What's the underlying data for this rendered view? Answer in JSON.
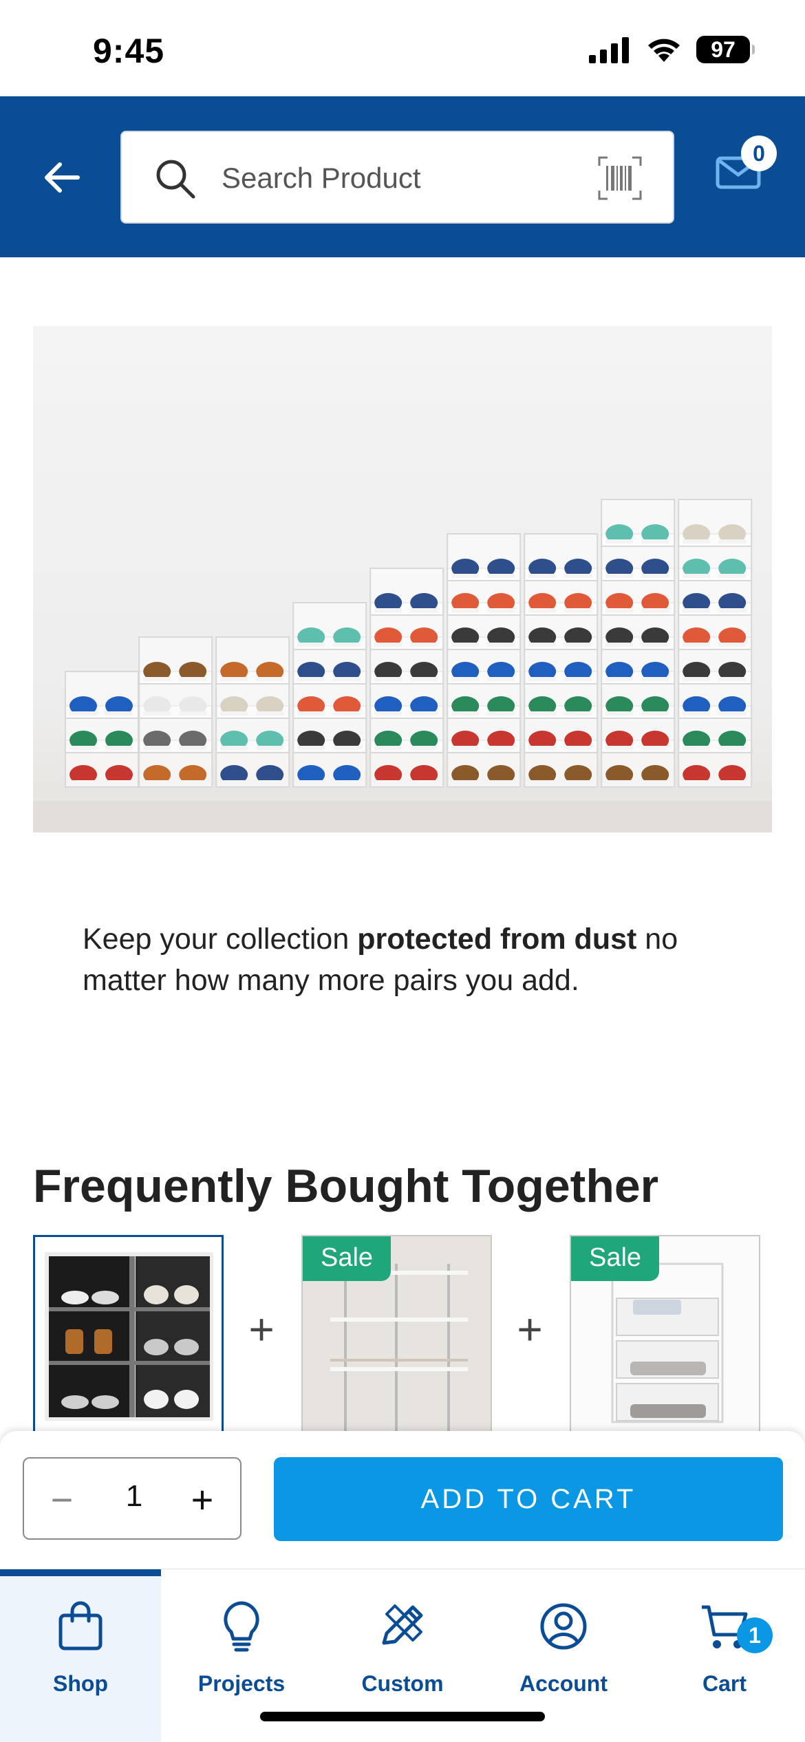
{
  "status_bar": {
    "time": "9:45",
    "battery": "97"
  },
  "header": {
    "search_placeholder": "Search Product",
    "mail_count": "0",
    "brand_color": "#0a4d95"
  },
  "hero": {
    "icon": "shoe-boxes-photo"
  },
  "tagline": {
    "prefix": "Keep your collection ",
    "bold": "protected from dust",
    "suffix": " no matter how many more pairs you add."
  },
  "fbt": {
    "title": "Frequently Bought Together",
    "plus": "+",
    "items": [
      {
        "badge": ""
      },
      {
        "badge": "Sale"
      },
      {
        "badge": "Sale"
      }
    ],
    "sale_color": "#1fa67a"
  },
  "action": {
    "quantity": "1",
    "minus": "−",
    "plus": "+",
    "add_to_cart": "ADD TO CART",
    "button_color": "#0a97e3"
  },
  "tabs": [
    {
      "label": "Shop",
      "icon": "shopping-bag-icon",
      "active": true
    },
    {
      "label": "Projects",
      "icon": "lightbulb-icon",
      "active": false
    },
    {
      "label": "Custom",
      "icon": "ruler-pencil-icon",
      "active": false
    },
    {
      "label": "Account",
      "icon": "account-icon",
      "active": false
    },
    {
      "label": "Cart",
      "icon": "cart-icon",
      "active": false,
      "badge": "1"
    }
  ]
}
